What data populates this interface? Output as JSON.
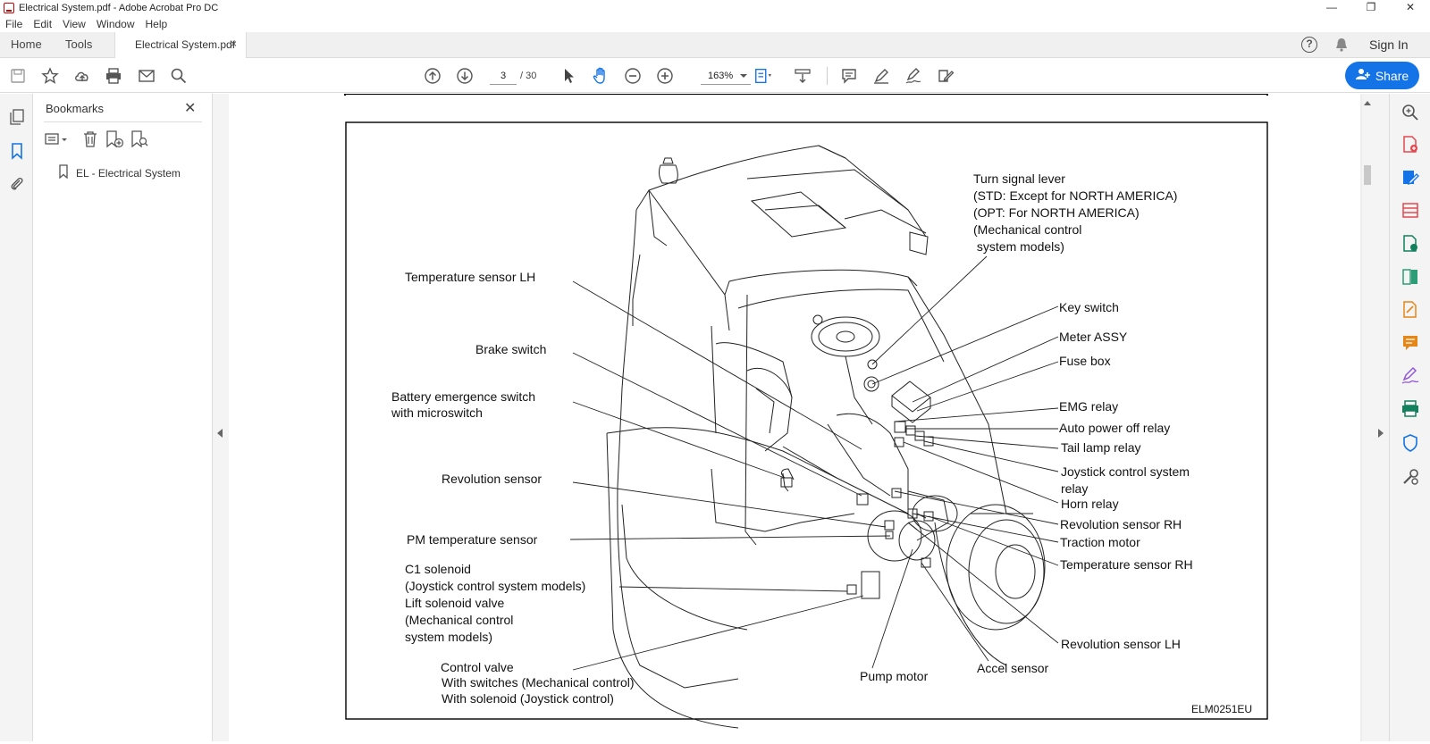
{
  "window": {
    "title": "Electrical System.pdf - Adobe Acrobat Pro DC",
    "minimize": "—",
    "maximize": "❐",
    "close": "✕"
  },
  "menu": [
    "File",
    "Edit",
    "View",
    "Window",
    "Help"
  ],
  "tabs": {
    "home": "Home",
    "tools": "Tools",
    "document": "Electrical System.pdf",
    "close": "×",
    "sign_in": "Sign In"
  },
  "toolbar": {
    "page_current": "3",
    "page_total": "/  30",
    "zoom": "163%",
    "share": "Share"
  },
  "bookmarks": {
    "title": "Bookmarks",
    "close": "✕",
    "items": [
      "EL - Electrical System"
    ]
  },
  "figure": {
    "code": "ELM0251EU",
    "labels_left": {
      "temperature_sensor_lh": "Temperature sensor LH",
      "brake_switch": "Brake switch",
      "battery_emergence_1": "Battery emergence switch",
      "battery_emergence_2": "with microswitch",
      "revolution_sensor": "Revolution sensor",
      "pm_temperature_sensor": "PM temperature sensor",
      "c1_solenoid_1": "C1 solenoid",
      "c1_solenoid_2": "(Joystick control system models)",
      "c1_solenoid_3": "Lift solenoid valve",
      "c1_solenoid_4": "(Mechanical control",
      "c1_solenoid_5": "system models)",
      "control_valve_1": "Control valve",
      "control_valve_2": "With switches (Mechanical control)",
      "control_valve_3": "With solenoid (Joystick control)"
    },
    "labels_right": {
      "turn_signal_1": "Turn signal lever",
      "turn_signal_2": "(STD: Except for NORTH AMERICA)",
      "turn_signal_3": "(OPT: For NORTH AMERICA)",
      "turn_signal_4": "(Mechanical control",
      "turn_signal_5": " system models)",
      "key_switch": "Key switch",
      "meter_assy": "Meter ASSY",
      "fuse_box": "Fuse box",
      "emg_relay": "EMG relay",
      "auto_power_off_relay": "Auto power off relay",
      "tail_lamp_relay": "Tail lamp relay",
      "joystick_relay_1": "Joystick control system",
      "joystick_relay_2": "relay",
      "horn_relay": "Horn relay",
      "revolution_sensor_rh": "Revolution sensor RH",
      "traction_motor": "Traction motor",
      "temperature_sensor_rh": "Temperature sensor RH",
      "revolution_sensor_lh": "Revolution sensor LH"
    },
    "labels_bottom": {
      "pump_motor": "Pump motor",
      "accel_sensor": "Accel sensor"
    }
  }
}
